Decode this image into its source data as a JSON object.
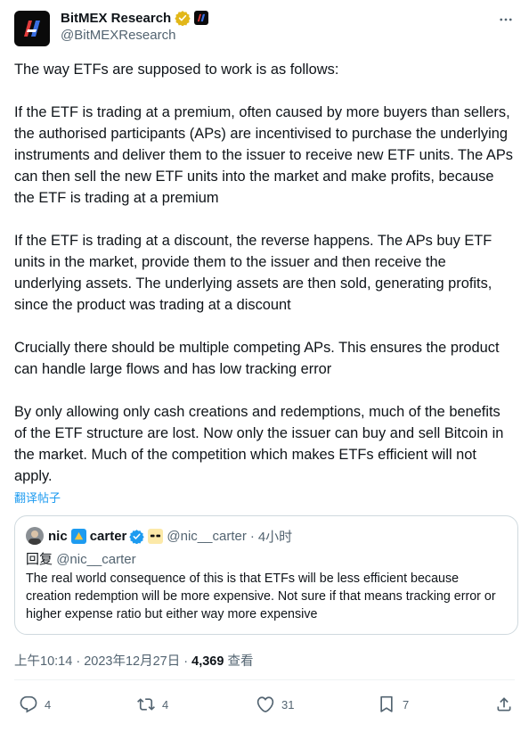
{
  "author": {
    "display_name": "BitMEX Research",
    "handle": "@BitMEXResearch"
  },
  "tweet": {
    "paragraphs": [
      "The way ETFs are supposed to work is as follows:",
      "If the ETF is trading at a premium, often caused by more buyers than sellers, the authorised participants (APs) are incentivised to purchase the underlying instruments and deliver them to the issuer to receive new ETF units. The APs can then sell the new ETF units into the market and make profits, because the ETF is trading at a premium",
      "If the ETF is trading at a discount, the reverse happens. The APs buy ETF units in the market, provide them to the issuer and then receive the underlying assets. The underlying assets are then sold, generating profits, since the product was trading at a discount",
      "Crucially there should be multiple competing APs. This ensures the product can handle large flows and has low tracking error",
      "By only allowing only cash creations and redemptions, much of the benefits of the ETF structure are lost. Now only the issuer can buy and sell Bitcoin in the market. Much of the competition which makes ETFs efficient will not apply."
    ],
    "translate_label": "翻译帖子"
  },
  "quoted": {
    "name_part1": "nic",
    "name_part2": "carter",
    "handle": "@nic__carter",
    "separator": "·",
    "time": "4小时",
    "reply_prefix": "回复",
    "reply_mention": "@nic__carter",
    "text": "The real world consequence of this is that ETFs will be less efficient because creation redemption will be more expensive. Not sure if that means tracking error or higher expense ratio but either way more expensive"
  },
  "meta": {
    "time": "上午10:14",
    "sep1": "·",
    "date": "2023年12月27日",
    "sep2": "·",
    "views": "4,369",
    "views_label": "查看"
  },
  "actions": {
    "replies": "4",
    "retweets": "4",
    "likes": "31",
    "bookmarks": "7"
  },
  "colors": {
    "link": "#1d9bf0",
    "muted": "#536471",
    "text": "#0f1419",
    "verified": "#1d9bf0",
    "gold_badge": "#e2b719"
  },
  "icons": [
    "bitmex-logo-icon",
    "verified-gold-icon",
    "org-badge-icon",
    "more-icon",
    "verified-blue-icon",
    "reply-icon",
    "retweet-icon",
    "like-icon",
    "bookmark-icon",
    "share-icon"
  ]
}
